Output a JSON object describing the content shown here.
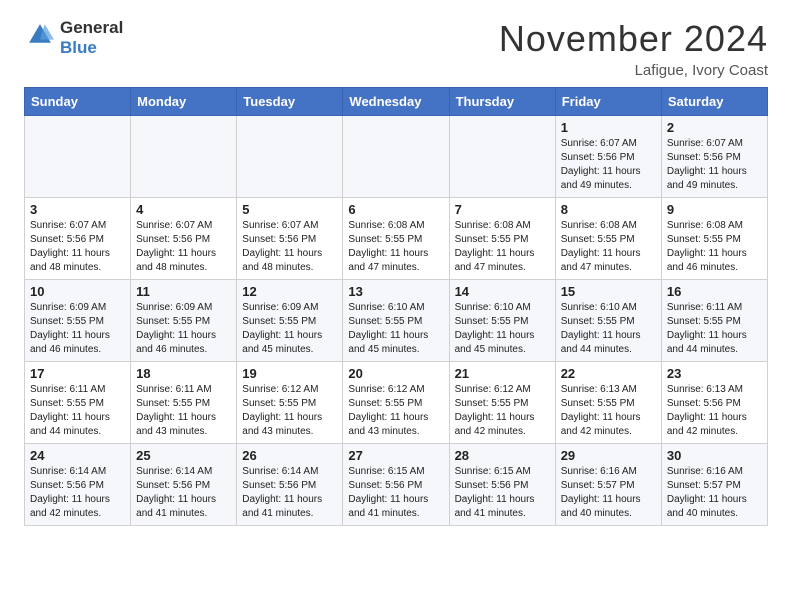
{
  "header": {
    "logo_line1": "General",
    "logo_line2": "Blue",
    "month_title": "November 2024",
    "location": "Lafigue, Ivory Coast"
  },
  "calendar": {
    "days_of_week": [
      "Sunday",
      "Monday",
      "Tuesday",
      "Wednesday",
      "Thursday",
      "Friday",
      "Saturday"
    ],
    "weeks": [
      [
        {
          "day": "",
          "content": ""
        },
        {
          "day": "",
          "content": ""
        },
        {
          "day": "",
          "content": ""
        },
        {
          "day": "",
          "content": ""
        },
        {
          "day": "",
          "content": ""
        },
        {
          "day": "1",
          "content": "Sunrise: 6:07 AM\nSunset: 5:56 PM\nDaylight: 11 hours and 49 minutes."
        },
        {
          "day": "2",
          "content": "Sunrise: 6:07 AM\nSunset: 5:56 PM\nDaylight: 11 hours and 49 minutes."
        }
      ],
      [
        {
          "day": "3",
          "content": "Sunrise: 6:07 AM\nSunset: 5:56 PM\nDaylight: 11 hours and 48 minutes."
        },
        {
          "day": "4",
          "content": "Sunrise: 6:07 AM\nSunset: 5:56 PM\nDaylight: 11 hours and 48 minutes."
        },
        {
          "day": "5",
          "content": "Sunrise: 6:07 AM\nSunset: 5:56 PM\nDaylight: 11 hours and 48 minutes."
        },
        {
          "day": "6",
          "content": "Sunrise: 6:08 AM\nSunset: 5:55 PM\nDaylight: 11 hours and 47 minutes."
        },
        {
          "day": "7",
          "content": "Sunrise: 6:08 AM\nSunset: 5:55 PM\nDaylight: 11 hours and 47 minutes."
        },
        {
          "day": "8",
          "content": "Sunrise: 6:08 AM\nSunset: 5:55 PM\nDaylight: 11 hours and 47 minutes."
        },
        {
          "day": "9",
          "content": "Sunrise: 6:08 AM\nSunset: 5:55 PM\nDaylight: 11 hours and 46 minutes."
        }
      ],
      [
        {
          "day": "10",
          "content": "Sunrise: 6:09 AM\nSunset: 5:55 PM\nDaylight: 11 hours and 46 minutes."
        },
        {
          "day": "11",
          "content": "Sunrise: 6:09 AM\nSunset: 5:55 PM\nDaylight: 11 hours and 46 minutes."
        },
        {
          "day": "12",
          "content": "Sunrise: 6:09 AM\nSunset: 5:55 PM\nDaylight: 11 hours and 45 minutes."
        },
        {
          "day": "13",
          "content": "Sunrise: 6:10 AM\nSunset: 5:55 PM\nDaylight: 11 hours and 45 minutes."
        },
        {
          "day": "14",
          "content": "Sunrise: 6:10 AM\nSunset: 5:55 PM\nDaylight: 11 hours and 45 minutes."
        },
        {
          "day": "15",
          "content": "Sunrise: 6:10 AM\nSunset: 5:55 PM\nDaylight: 11 hours and 44 minutes."
        },
        {
          "day": "16",
          "content": "Sunrise: 6:11 AM\nSunset: 5:55 PM\nDaylight: 11 hours and 44 minutes."
        }
      ],
      [
        {
          "day": "17",
          "content": "Sunrise: 6:11 AM\nSunset: 5:55 PM\nDaylight: 11 hours and 44 minutes."
        },
        {
          "day": "18",
          "content": "Sunrise: 6:11 AM\nSunset: 5:55 PM\nDaylight: 11 hours and 43 minutes."
        },
        {
          "day": "19",
          "content": "Sunrise: 6:12 AM\nSunset: 5:55 PM\nDaylight: 11 hours and 43 minutes."
        },
        {
          "day": "20",
          "content": "Sunrise: 6:12 AM\nSunset: 5:55 PM\nDaylight: 11 hours and 43 minutes."
        },
        {
          "day": "21",
          "content": "Sunrise: 6:12 AM\nSunset: 5:55 PM\nDaylight: 11 hours and 42 minutes."
        },
        {
          "day": "22",
          "content": "Sunrise: 6:13 AM\nSunset: 5:55 PM\nDaylight: 11 hours and 42 minutes."
        },
        {
          "day": "23",
          "content": "Sunrise: 6:13 AM\nSunset: 5:56 PM\nDaylight: 11 hours and 42 minutes."
        }
      ],
      [
        {
          "day": "24",
          "content": "Sunrise: 6:14 AM\nSunset: 5:56 PM\nDaylight: 11 hours and 42 minutes."
        },
        {
          "day": "25",
          "content": "Sunrise: 6:14 AM\nSunset: 5:56 PM\nDaylight: 11 hours and 41 minutes."
        },
        {
          "day": "26",
          "content": "Sunrise: 6:14 AM\nSunset: 5:56 PM\nDaylight: 11 hours and 41 minutes."
        },
        {
          "day": "27",
          "content": "Sunrise: 6:15 AM\nSunset: 5:56 PM\nDaylight: 11 hours and 41 minutes."
        },
        {
          "day": "28",
          "content": "Sunrise: 6:15 AM\nSunset: 5:56 PM\nDaylight: 11 hours and 41 minutes."
        },
        {
          "day": "29",
          "content": "Sunrise: 6:16 AM\nSunset: 5:57 PM\nDaylight: 11 hours and 40 minutes."
        },
        {
          "day": "30",
          "content": "Sunrise: 6:16 AM\nSunset: 5:57 PM\nDaylight: 11 hours and 40 minutes."
        }
      ]
    ]
  }
}
